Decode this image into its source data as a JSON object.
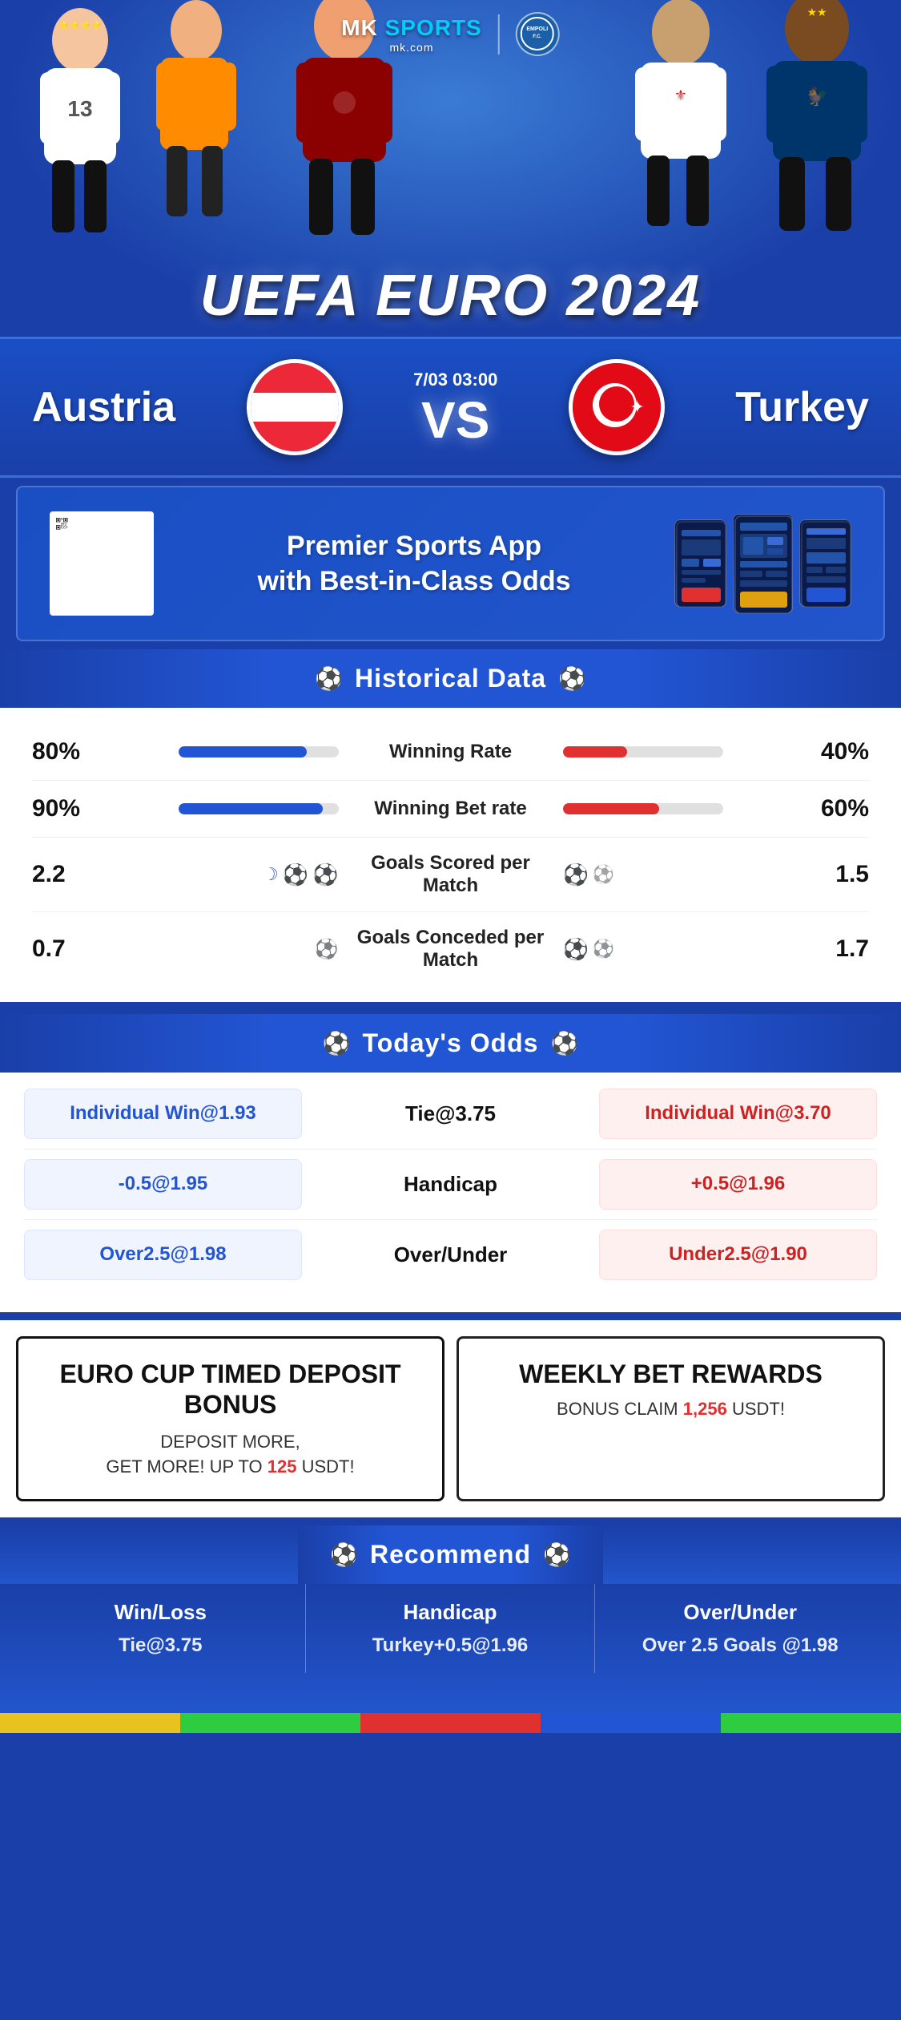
{
  "brand": {
    "name": "MK SPORTS",
    "sub": "mk.com",
    "logo_text": "MK SPORTS",
    "partner": "EMPOLI F.C."
  },
  "banner": {
    "title": "UEFA EURO 2024"
  },
  "match": {
    "team_left": "Austria",
    "team_right": "Turkey",
    "date": "7/03 03:00",
    "vs": "VS"
  },
  "promo": {
    "line1": "Premier Sports App",
    "line2": "with Best-in-Class Odds"
  },
  "historical": {
    "title": "Historical Data",
    "stats": [
      {
        "label": "Winning Rate",
        "left_val": "80%",
        "right_val": "40%",
        "left_pct": 80,
        "right_pct": 40,
        "type": "bar"
      },
      {
        "label": "Winning Bet rate",
        "left_val": "90%",
        "right_val": "60%",
        "left_pct": 90,
        "right_pct": 60,
        "type": "bar"
      },
      {
        "label": "Goals Scored per Match",
        "left_val": "2.2",
        "right_val": "1.5",
        "type": "icons"
      },
      {
        "label": "Goals Conceded per Match",
        "left_val": "0.7",
        "right_val": "1.7",
        "type": "icons"
      }
    ]
  },
  "odds": {
    "title": "Today's Odds",
    "rows": [
      {
        "left": "Individual Win@1.93",
        "center": "Tie@3.75",
        "right": "Individual Win@3.70",
        "left_color": "blue",
        "right_color": "red"
      },
      {
        "left": "-0.5@1.95",
        "center": "Handicap",
        "right": "+0.5@1.96",
        "left_color": "blue",
        "right_color": "red"
      },
      {
        "left": "Over2.5@1.98",
        "center": "Over/Under",
        "right": "Under2.5@1.90",
        "left_color": "blue",
        "right_color": "red"
      }
    ]
  },
  "bonus": {
    "left_title": "EURO CUP TIMED DEPOSIT BONUS",
    "left_desc1": "DEPOSIT MORE,",
    "left_desc2": "GET MORE! UP TO",
    "left_amount": "125",
    "left_currency": "USDT!",
    "right_title": "WEEKLY BET REWARDS",
    "right_desc": "BONUS CLAIM",
    "right_amount": "1,256",
    "right_currency": "USDT!"
  },
  "recommend": {
    "title": "Recommend",
    "cols": [
      {
        "title": "Win/Loss",
        "value": "Tie@3.75"
      },
      {
        "title": "Handicap",
        "value": "Turkey+0.5@1.96"
      },
      {
        "title": "Over/Under",
        "value": "Over 2.5 Goals @1.98"
      }
    ]
  },
  "bottom_strip": {
    "colors": [
      "#e8c320",
      "#2ecc40",
      "#e03030",
      "#2255d4",
      "#2ecc40"
    ]
  }
}
